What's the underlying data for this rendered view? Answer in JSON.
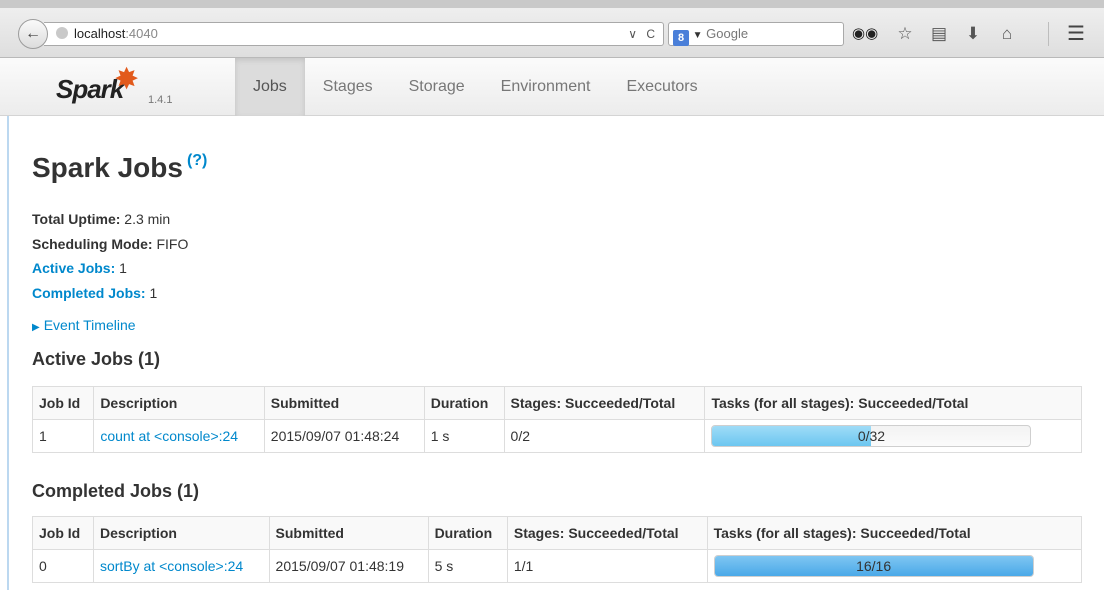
{
  "browser": {
    "url_host": "localhost",
    "url_port": ":4040",
    "url_dropdown": "∨",
    "reload": "C",
    "search_engine_letter": "8",
    "search_placeholder": "Google",
    "icons": [
      "binoculars-icon",
      "star-icon",
      "clipboard-icon",
      "download-icon",
      "home-icon",
      "menu-icon"
    ]
  },
  "spark": {
    "logo_text": "Spark",
    "version": "1.4.1",
    "tabs": [
      {
        "label": "Jobs",
        "active": true
      },
      {
        "label": "Stages",
        "active": false
      },
      {
        "label": "Storage",
        "active": false
      },
      {
        "label": "Environment",
        "active": false
      },
      {
        "label": "Executors",
        "active": false
      }
    ]
  },
  "page": {
    "title": "Spark Jobs",
    "help": "(?)",
    "uptime_label": "Total Uptime:",
    "uptime_value": "2.3 min",
    "mode_label": "Scheduling Mode:",
    "mode_value": "FIFO",
    "active_label": "Active Jobs:",
    "active_value": "1",
    "completed_label": "Completed Jobs:",
    "completed_value": "1",
    "timeline": "Event Timeline"
  },
  "headers": [
    "Job Id",
    "Description",
    "Submitted",
    "Duration",
    "Stages: Succeeded/Total",
    "Tasks (for all stages): Succeeded/Total"
  ],
  "active_jobs": {
    "title": "Active Jobs (1)",
    "rows": [
      {
        "id": "1",
        "description": "count at <console>:24",
        "submitted": "2015/09/07 01:48:24",
        "duration": "1 s",
        "stages": "0/2",
        "tasks": "0/32",
        "progress": 0.5
      }
    ]
  },
  "completed_jobs": {
    "title": "Completed Jobs (1)",
    "rows": [
      {
        "id": "0",
        "description": "sortBy at <console>:24",
        "submitted": "2015/09/07 01:48:19",
        "duration": "5 s",
        "stages": "1/1",
        "tasks": "16/16",
        "progress": 1.0
      }
    ]
  }
}
